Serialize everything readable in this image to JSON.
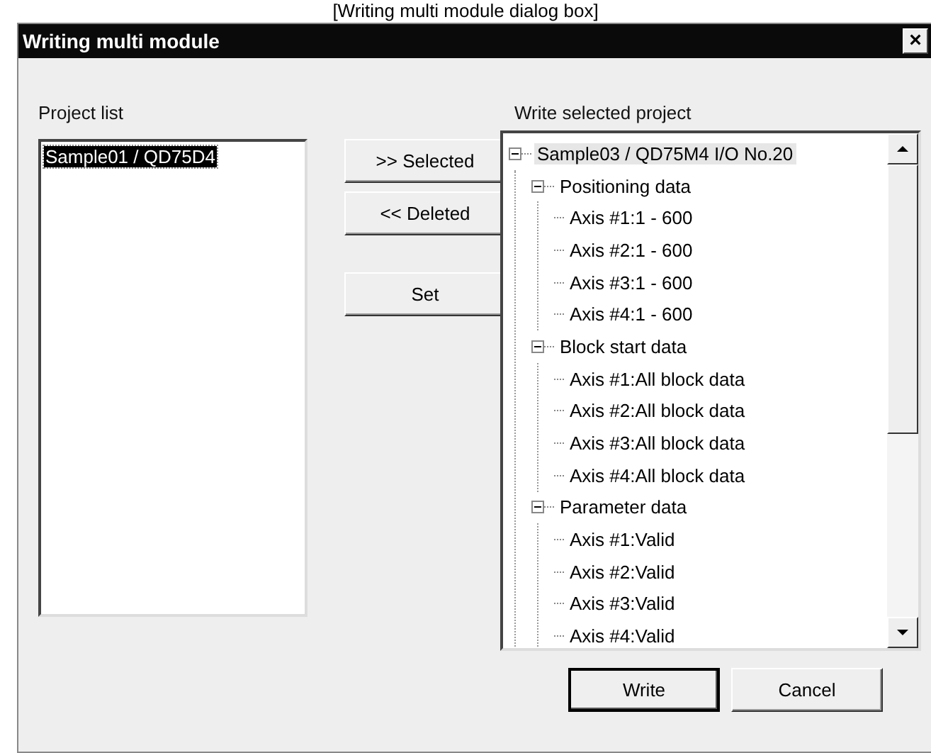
{
  "caption": "[Writing multi module dialog box]",
  "window": {
    "title": "Writing multi module",
    "close": "×"
  },
  "project_list": {
    "label": "Project list",
    "items": [
      {
        "label": "Sample01 / QD75D4",
        "selected": true
      }
    ]
  },
  "middle_buttons": [
    {
      "label": ">> Selected"
    },
    {
      "label": "<< Deleted"
    },
    {
      "label": "Set"
    }
  ],
  "write_selected_project": {
    "label": "Write selected project",
    "tree": [
      {
        "label": "Sample03 / QD75M4 I/O No.20",
        "selected": true,
        "expanded": true,
        "children": [
          {
            "label": "Positioning data",
            "selected": false,
            "expanded": true,
            "children": [
              {
                "label": "Axis #1:1 - 600",
                "selected": false
              },
              {
                "label": "Axis #2:1 - 600",
                "selected": false
              },
              {
                "label": "Axis #3:1 - 600",
                "selected": false
              },
              {
                "label": "Axis #4:1 - 600",
                "selected": false
              }
            ]
          },
          {
            "label": "Block start data",
            "selected": false,
            "expanded": true,
            "children": [
              {
                "label": "Axis #1:All block data",
                "selected": false
              },
              {
                "label": "Axis #2:All block data",
                "selected": false
              },
              {
                "label": "Axis #3:All block data",
                "selected": false
              },
              {
                "label": "Axis #4:All block data",
                "selected": false
              }
            ]
          },
          {
            "label": "Parameter data",
            "selected": false,
            "expanded": true,
            "children": [
              {
                "label": "Axis #1:Valid",
                "selected": false
              },
              {
                "label": "Axis #2:Valid",
                "selected": false
              },
              {
                "label": "Axis #3:Valid",
                "selected": false
              },
              {
                "label": "Axis #4:Valid",
                "selected": false
              }
            ]
          }
        ]
      }
    ]
  },
  "bottom_buttons": [
    {
      "label": "Write",
      "default": true
    },
    {
      "label": "Cancel",
      "default": false
    }
  ]
}
